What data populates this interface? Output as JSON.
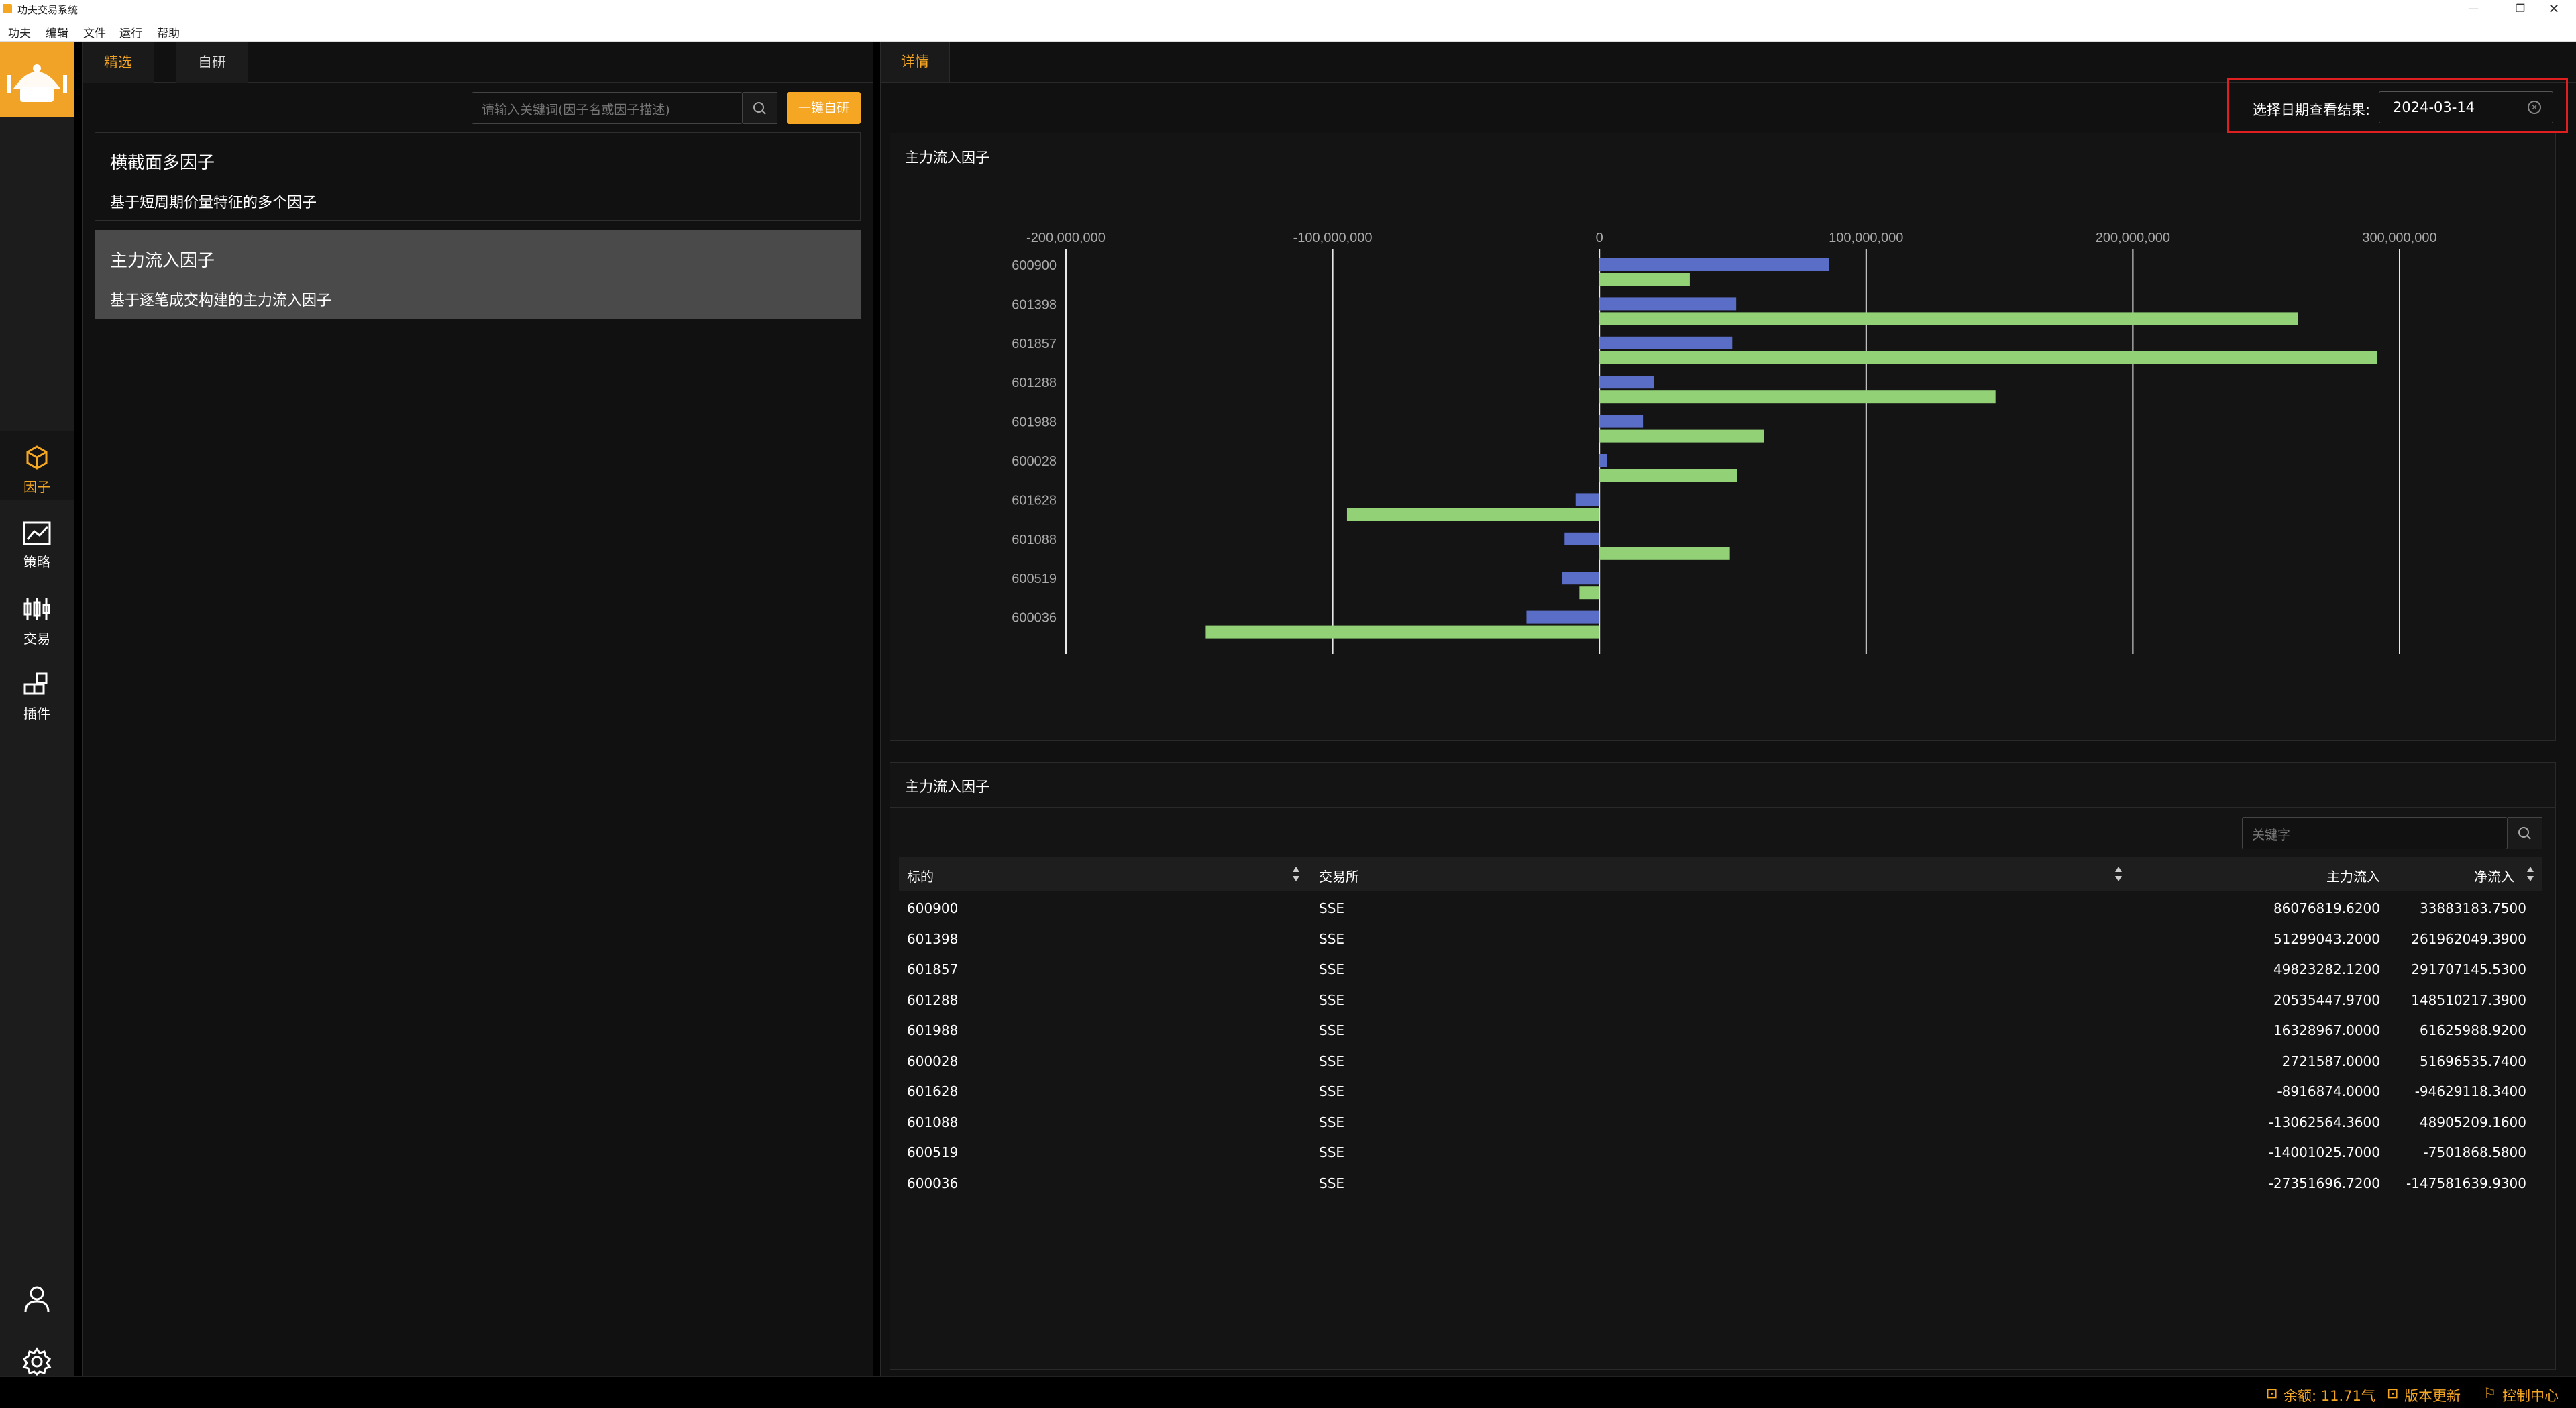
{
  "window": {
    "title": "功夫交易系统"
  },
  "menu": [
    "功夫",
    "编辑",
    "文件",
    "运行",
    "帮助"
  ],
  "rail": {
    "items": [
      {
        "label": "因子",
        "icon": "cube-icon"
      },
      {
        "label": "策略",
        "icon": "line-chart-icon"
      },
      {
        "label": "交易",
        "icon": "candlestick-icon"
      },
      {
        "label": "插件",
        "icon": "blocks-icon"
      }
    ],
    "bottom": [
      {
        "icon": "user-icon"
      },
      {
        "icon": "gear-icon"
      }
    ]
  },
  "left": {
    "tabs": [
      "精选",
      "自研"
    ],
    "search_placeholder": "请输入关键词(因子名或因子描述)",
    "research_button": "一键自研",
    "factors": [
      {
        "name": "横截面多因子",
        "desc": "基于短周期价量特征的多个因子"
      },
      {
        "name": "主力流入因子",
        "desc": "基于逐笔成交构建的主力流入因子"
      }
    ]
  },
  "right": {
    "tab": "详情",
    "date_label": "选择日期查看结果:",
    "date_value": "2024-03-14"
  },
  "chart_card": {
    "title": "主力流入因子"
  },
  "table_card": {
    "title": "主力流入因子",
    "search_placeholder": "关键字"
  },
  "colors": {
    "accent": "#f5a623",
    "series_main": "#5a6ec8",
    "series_net": "#93d177",
    "highlight_box": "#e02020"
  },
  "chart_data": {
    "type": "bar",
    "orientation": "horizontal",
    "categories": [
      "600900",
      "601398",
      "601857",
      "601288",
      "601988",
      "600028",
      "601628",
      "601088",
      "600519",
      "600036"
    ],
    "series": [
      {
        "values": [
          86076819.62,
          51299043.2,
          49823282.12,
          20535447.97,
          16328967.0,
          2721587.0,
          -8916874.0,
          -13062564.36,
          -14001025.7,
          -27351696.72
        ]
      },
      {
        "values": [
          33883183.75,
          261962049.39,
          291707145.53,
          148510217.39,
          61625988.92,
          51696535.74,
          -94629118.34,
          48905209.16,
          -7501868.58,
          -147581639.93
        ]
      }
    ],
    "x_ticks": [
      "-200,000,000",
      "-100,000,000",
      "0",
      "100,000,000",
      "200,000,000",
      "300,000,000"
    ],
    "xlim": [
      -200000000,
      300000000
    ],
    "grid": true
  },
  "table": {
    "columns": [
      "标的",
      "交易所",
      "主力流入",
      "净流入"
    ],
    "rows": [
      [
        "600900",
        "SSE",
        "86076819.6200",
        "33883183.7500"
      ],
      [
        "601398",
        "SSE",
        "51299043.2000",
        "261962049.3900"
      ],
      [
        "601857",
        "SSE",
        "49823282.1200",
        "291707145.5300"
      ],
      [
        "601288",
        "SSE",
        "20535447.9700",
        "148510217.3900"
      ],
      [
        "601988",
        "SSE",
        "16328967.0000",
        "61625988.9200"
      ],
      [
        "600028",
        "SSE",
        "2721587.0000",
        "51696535.7400"
      ],
      [
        "601628",
        "SSE",
        "-8916874.0000",
        "-94629118.3400"
      ],
      [
        "601088",
        "SSE",
        "-13062564.3600",
        "48905209.1600"
      ],
      [
        "600519",
        "SSE",
        "-14001025.7000",
        "-7501868.5800"
      ],
      [
        "600036",
        "SSE",
        "-27351696.7200",
        "-147581639.9300"
      ]
    ]
  },
  "status": {
    "balance": "余额: 11.71气",
    "update": "版本更新",
    "control": "控制中心"
  }
}
